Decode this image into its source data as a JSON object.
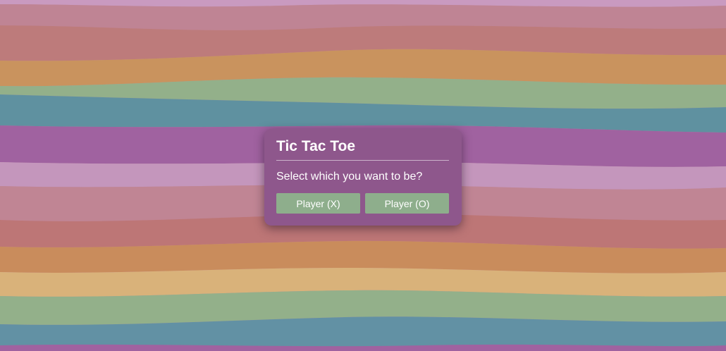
{
  "dialog": {
    "title": "Tic Tac Toe",
    "prompt": "Select which you want to be?",
    "buttons": [
      {
        "label": "Player (X)"
      },
      {
        "label": "Player (O)"
      }
    ]
  },
  "colors": {
    "dialog_background": "#8e578c",
    "button_background": "#8eae8c",
    "text": "#ffffff"
  }
}
